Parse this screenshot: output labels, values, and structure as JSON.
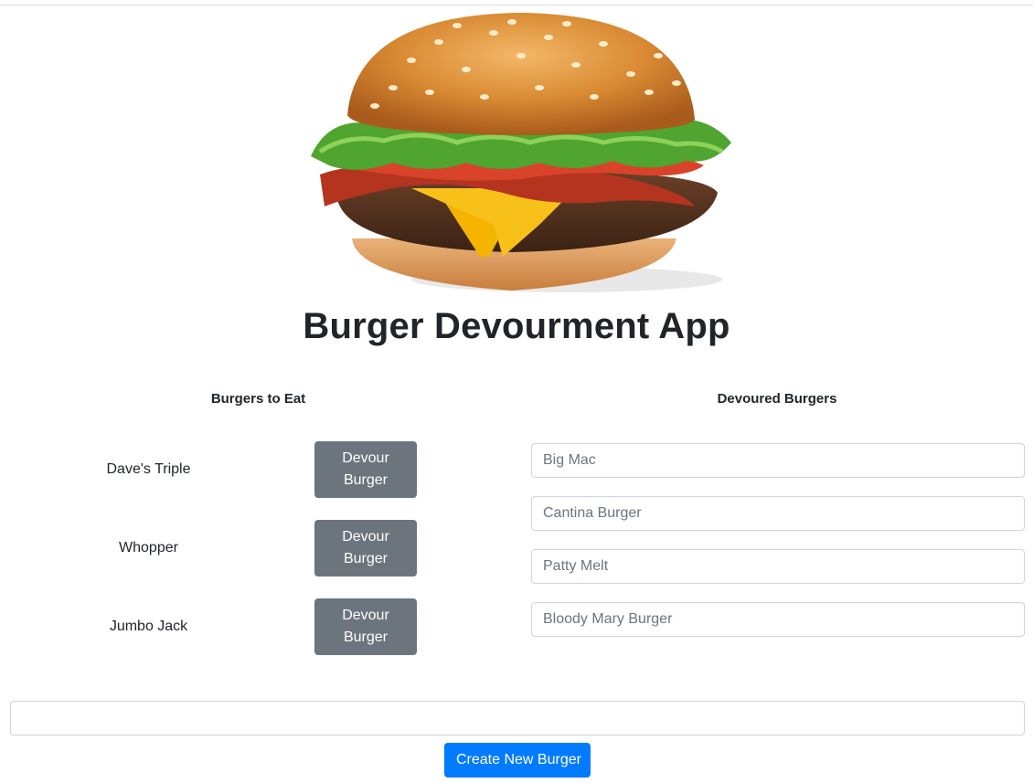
{
  "page": {
    "title": "Burger Devourment App"
  },
  "hero": {
    "image": "hamburger-photo"
  },
  "columns": {
    "to_eat_heading": "Burgers to Eat",
    "devoured_heading": "Devoured Burgers"
  },
  "burgers_to_eat": [
    {
      "name": "Dave's Triple",
      "button_label": "Devour Burger"
    },
    {
      "name": "Whopper",
      "button_label": "Devour Burger"
    },
    {
      "name": "Jumbo Jack",
      "button_label": "Devour Burger"
    }
  ],
  "devoured_burgers": [
    {
      "name": "Big Mac"
    },
    {
      "name": "Cantina Burger"
    },
    {
      "name": "Patty Melt"
    },
    {
      "name": "Bloody Mary Burger"
    }
  ],
  "create_form": {
    "input_value": "",
    "button_label": "Create New Burger"
  },
  "colors": {
    "devour_button": "#6c757d",
    "create_button": "#007bff",
    "text": "#212529",
    "field_text": "#6c757d"
  }
}
